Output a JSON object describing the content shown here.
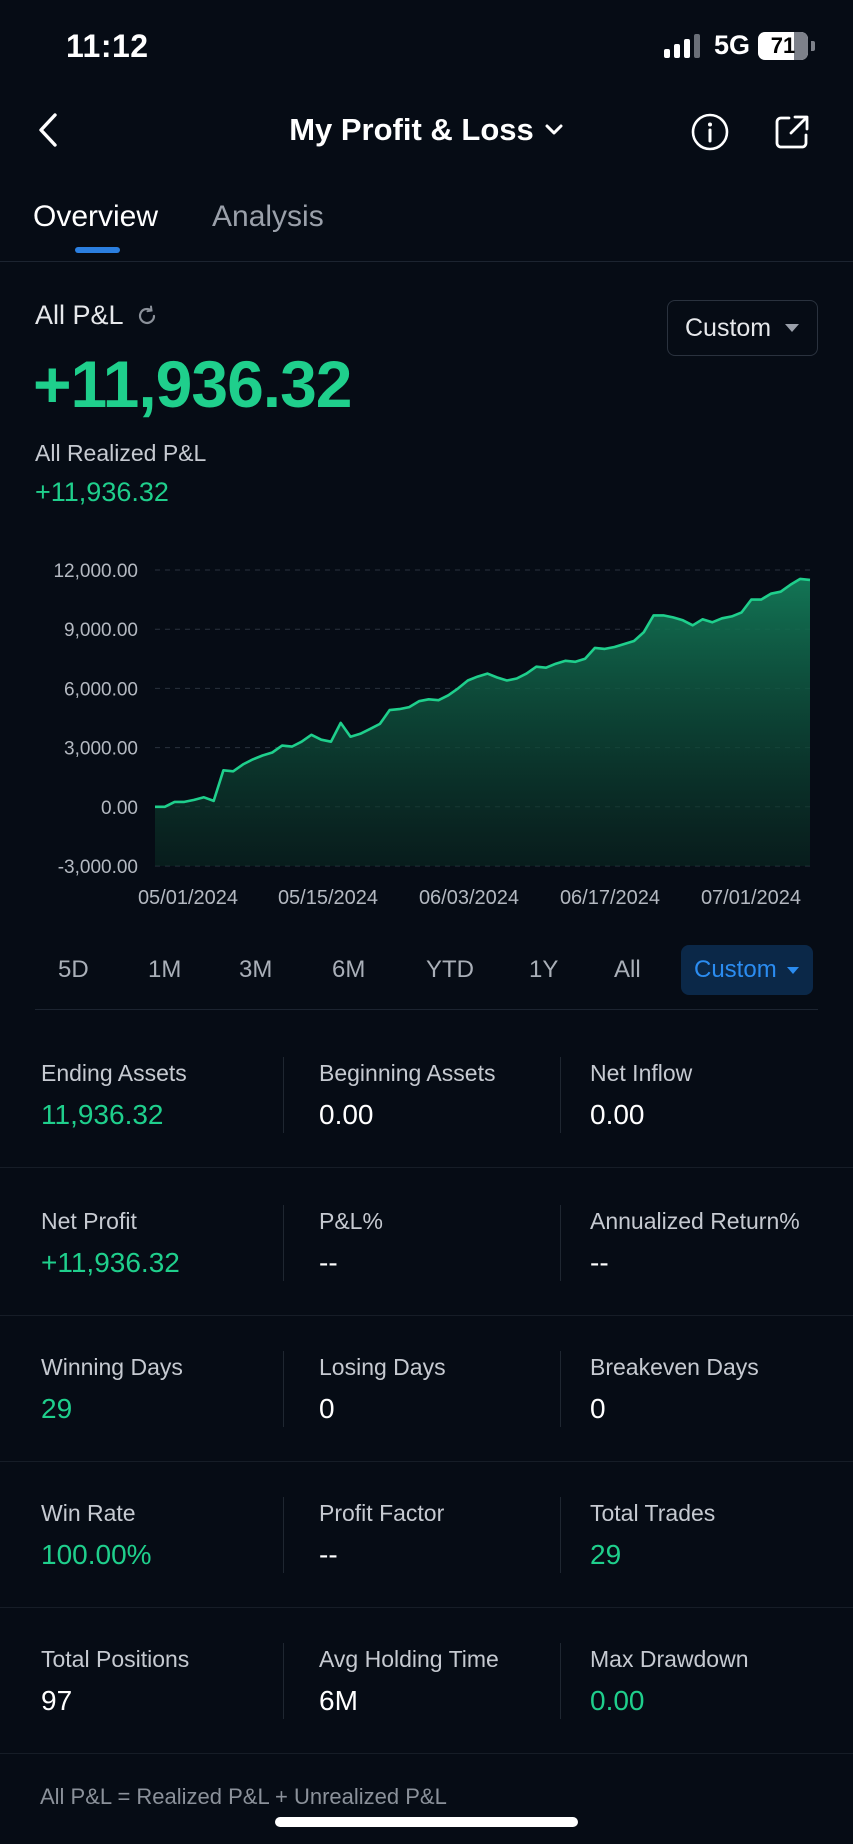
{
  "status_bar": {
    "time": "11:12",
    "network": "5G",
    "battery": "71"
  },
  "header": {
    "title": "My Profit & Loss"
  },
  "tabs": [
    {
      "label": "Overview",
      "active": true
    },
    {
      "label": "Analysis",
      "active": false
    }
  ],
  "summary": {
    "all_pl_label": "All P&L",
    "all_pl_value": "+11,936.32",
    "realized_label": "All Realized P&L",
    "realized_value": "+11,936.32",
    "period_dropdown": "Custom"
  },
  "chart_data": {
    "type": "area",
    "ylim": [
      -3000,
      12000
    ],
    "yticks": [
      "12,000.00",
      "9,000.00",
      "6,000.00",
      "3,000.00",
      "0.00",
      "-3,000.00"
    ],
    "ytick_values": [
      12000,
      9000,
      6000,
      3000,
      0,
      -3000
    ],
    "xtick_labels": [
      "05/01/2024",
      "05/15/2024",
      "06/03/2024",
      "06/17/2024",
      "07/01/2024"
    ],
    "grid": true,
    "color": "#1fcf8c",
    "values": [
      0,
      0,
      250,
      250,
      350,
      480,
      300,
      1850,
      1800,
      2150,
      2400,
      2600,
      2750,
      3100,
      3050,
      3300,
      3650,
      3400,
      3300,
      4250,
      3550,
      3700,
      3950,
      4200,
      4900,
      4950,
      5050,
      5350,
      5450,
      5400,
      5650,
      6000,
      6400,
      6600,
      6750,
      6550,
      6400,
      6500,
      6750,
      7100,
      7050,
      7250,
      7400,
      7350,
      7500,
      8050,
      8000,
      8100,
      8250,
      8400,
      8850,
      9700,
      9700,
      9600,
      9450,
      9200,
      9500,
      9350,
      9550,
      9650,
      9850,
      10500,
      10500,
      10800,
      10900,
      11250,
      11550,
      11500
    ]
  },
  "ranges": [
    {
      "label": "5D",
      "active": false
    },
    {
      "label": "1M",
      "active": false
    },
    {
      "label": "3M",
      "active": false
    },
    {
      "label": "6M",
      "active": false
    },
    {
      "label": "YTD",
      "active": false
    },
    {
      "label": "1Y",
      "active": false
    },
    {
      "label": "All",
      "active": false
    },
    {
      "label": "Custom",
      "active": true
    }
  ],
  "stats": [
    [
      {
        "label": "Ending Assets",
        "value": "11,936.32",
        "green": true
      },
      {
        "label": "Beginning Assets",
        "value": "0.00",
        "green": false
      },
      {
        "label": "Net Inflow",
        "value": "0.00",
        "green": false
      }
    ],
    [
      {
        "label": "Net Profit",
        "value": "+11,936.32",
        "green": true
      },
      {
        "label": "P&L%",
        "value": "--",
        "green": false
      },
      {
        "label": "Annualized Return%",
        "value": "--",
        "green": false
      }
    ],
    [
      {
        "label": "Winning Days",
        "value": "29",
        "green": true
      },
      {
        "label": "Losing Days",
        "value": "0",
        "green": false
      },
      {
        "label": "Breakeven Days",
        "value": "0",
        "green": false
      }
    ],
    [
      {
        "label": "Win Rate",
        "value": "100.00%",
        "green": true
      },
      {
        "label": "Profit Factor",
        "value": "--",
        "green": false
      },
      {
        "label": "Total Trades",
        "value": "29",
        "green": true
      }
    ],
    [
      {
        "label": "Total Positions",
        "value": "97",
        "green": false
      },
      {
        "label": "Avg Holding Time",
        "value": "6M",
        "green": false
      },
      {
        "label": "Max Drawdown",
        "value": "0.00",
        "green": true
      }
    ]
  ],
  "footnote": "All P&L = Realized P&L + Unrealized P&L"
}
